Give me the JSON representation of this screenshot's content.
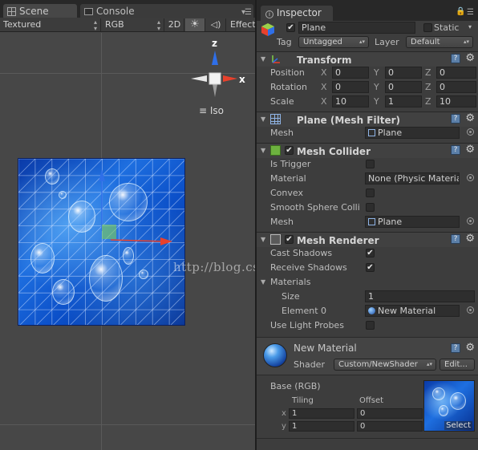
{
  "scene": {
    "tabs": [
      {
        "label": "Scene",
        "icon": "grid-icon"
      },
      {
        "label": "Console",
        "icon": "console-icon"
      }
    ],
    "toolbar": {
      "render_mode": "Textured",
      "color_mode": "RGB",
      "mode_2d": "2D",
      "effects": "Effect"
    },
    "gizmo": {
      "z_label": "z",
      "x_label": "x",
      "projection": "Iso"
    },
    "watermark": "http://blog.csdn.net/"
  },
  "inspector": {
    "tab_label": "Inspector",
    "object": {
      "name": "Plane",
      "active": true,
      "static_label": "Static",
      "static": false,
      "tag_label": "Tag",
      "tag_value": "Untagged",
      "layer_label": "Layer",
      "layer_value": "Default"
    },
    "transform": {
      "title": "Transform",
      "rows": [
        {
          "label": "Position",
          "x": "0",
          "y": "0",
          "z": "0"
        },
        {
          "label": "Rotation",
          "x": "0",
          "y": "0",
          "z": "0"
        },
        {
          "label": "Scale",
          "x": "10",
          "y": "1",
          "z": "10"
        }
      ],
      "axis_labels": [
        "X",
        "Y",
        "Z"
      ]
    },
    "mesh_filter": {
      "title": "Plane (Mesh Filter)",
      "mesh_label": "Mesh",
      "mesh_value": "Plane"
    },
    "mesh_collider": {
      "title": "Mesh Collider",
      "enabled": true,
      "is_trigger_label": "Is Trigger",
      "material_label": "Material",
      "material_value": "None (Physic Materia",
      "convex_label": "Convex",
      "smooth_label": "Smooth Sphere Colli",
      "mesh_label": "Mesh",
      "mesh_value": "Plane"
    },
    "mesh_renderer": {
      "title": "Mesh Renderer",
      "enabled": true,
      "cast_label": "Cast Shadows",
      "receive_label": "Receive Shadows",
      "materials_label": "Materials",
      "size_label": "Size",
      "size_value": "1",
      "element_label": "Element 0",
      "element_value": "New Material",
      "light_probes_label": "Use Light Probes"
    },
    "material": {
      "name": "New Material",
      "shader_label": "Shader",
      "shader_value": "Custom/NewShader",
      "edit_label": "Edit...",
      "base_label": "Base (RGB)",
      "tiling_label": "Tiling",
      "offset_label": "Offset",
      "x_label": "x",
      "y_label": "y",
      "tiling_x": "1",
      "tiling_y": "1",
      "offset_x": "0",
      "offset_y": "0",
      "select_label": "Select"
    }
  },
  "colors": {
    "axis_x": "#e8412c",
    "axis_y": "#7fd14a",
    "axis_z": "#2f6fe8",
    "help": "#5b7fa8"
  }
}
